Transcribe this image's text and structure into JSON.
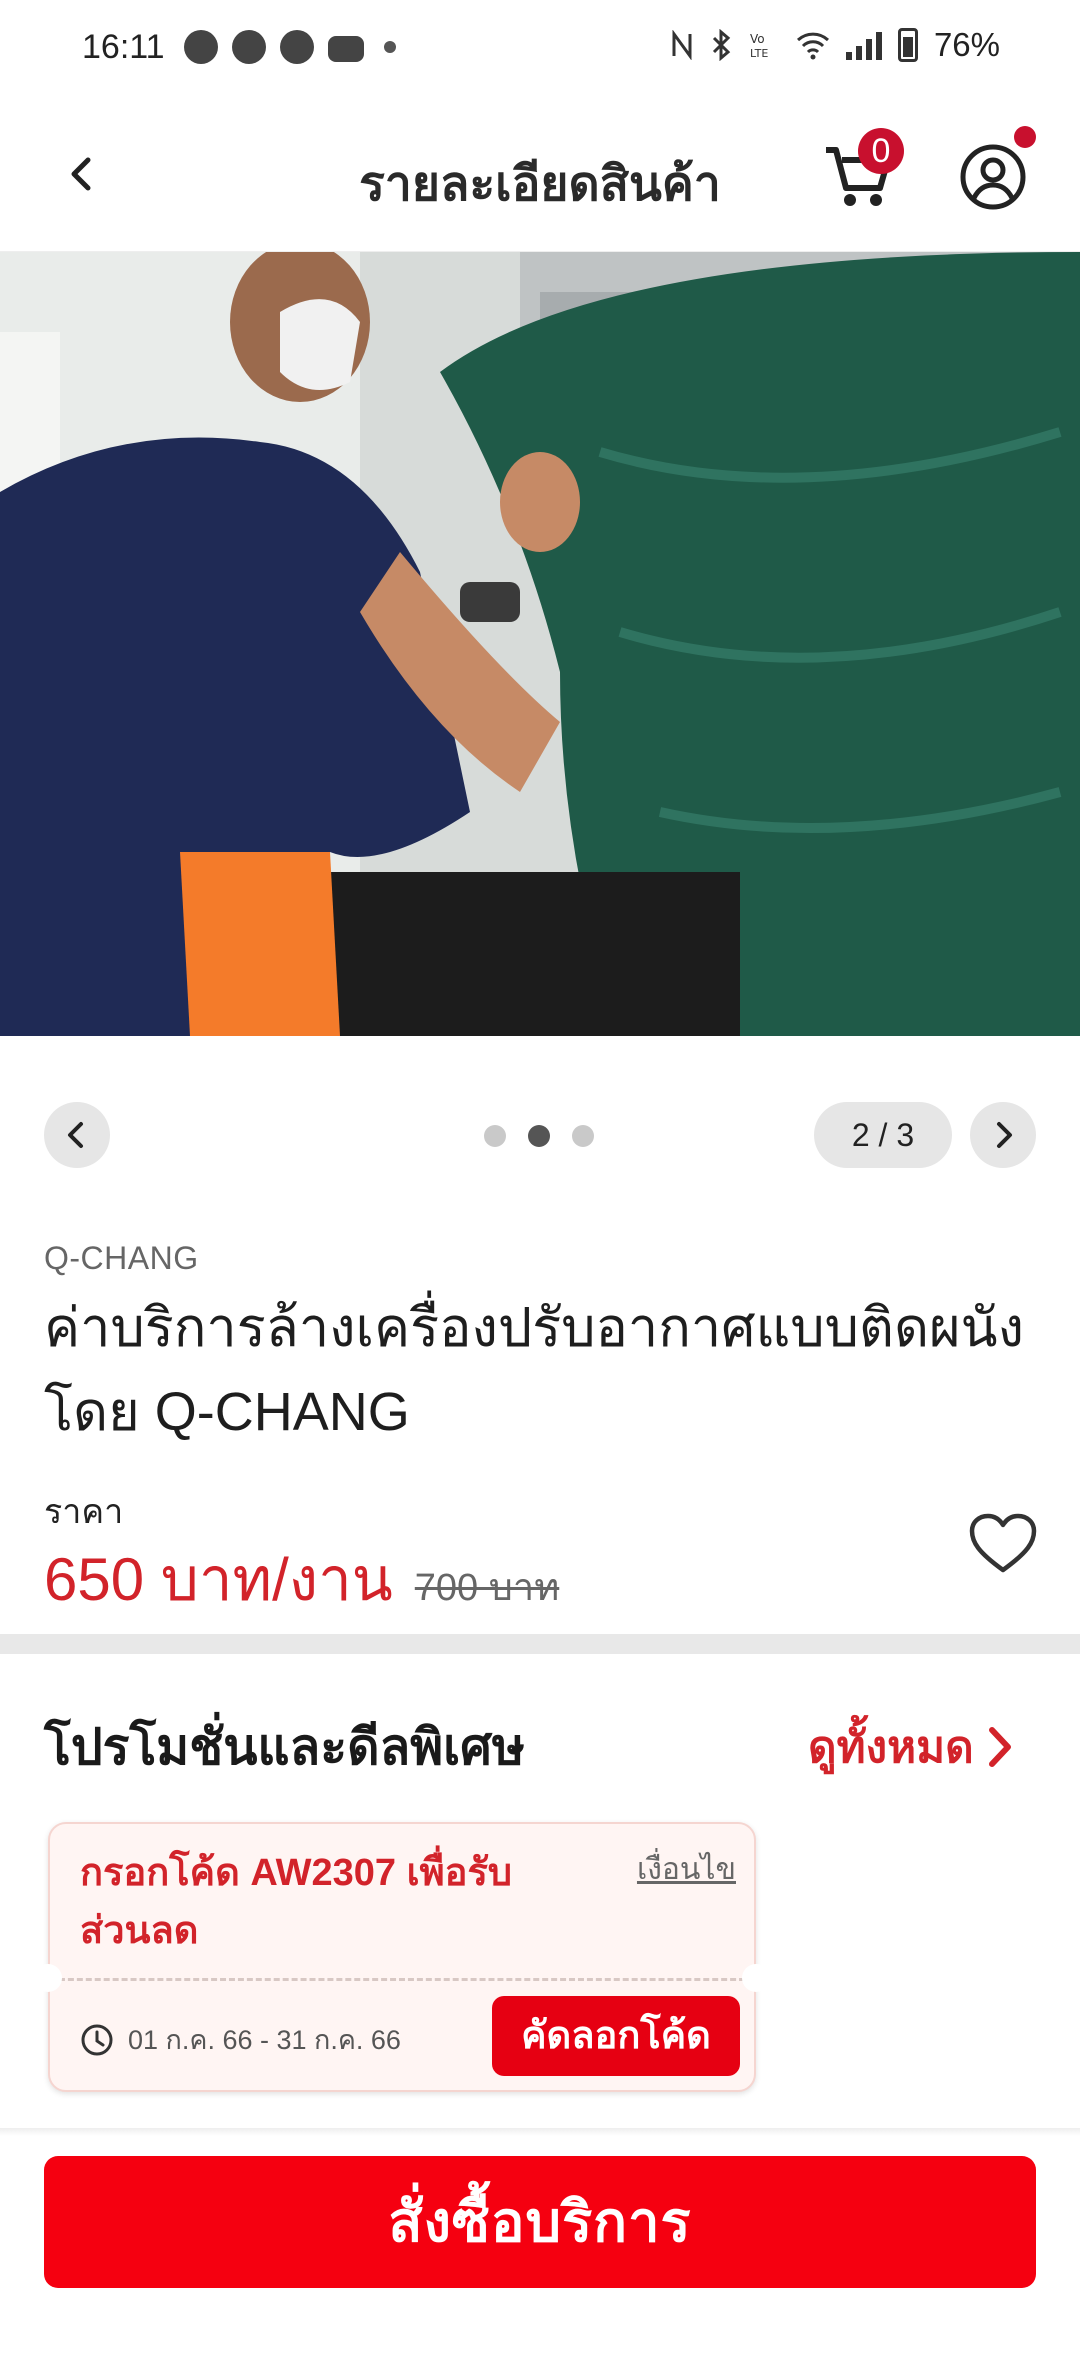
{
  "status_bar": {
    "time": "16:11",
    "battery": "76%",
    "icons": [
      "photo-app-icon",
      "messenger-icon",
      "speedometer-icon",
      "youtube-icon",
      "nfc-icon",
      "bluetooth-icon",
      "volte-icon",
      "wifi-icon",
      "signal-icon",
      "battery-icon"
    ]
  },
  "header": {
    "title": "รายละเอียดสินค้า",
    "cart_count": "0"
  },
  "gallery": {
    "counter": "2 / 3",
    "total": 3,
    "active_index": 2
  },
  "product": {
    "brand": "Q-CHANG",
    "title": "ค่าบริการล้างเครื่องปรับอากาศแบบติดผนัง โดย Q-CHANG",
    "price_label": "ราคา",
    "price": "650 บาท/งาน",
    "old_price": "700 บาท"
  },
  "promotions": {
    "title": "โปรโมชั่นและดีลพิเศษ",
    "see_all": "ดูทั้งหมด",
    "coupon": {
      "text": "กรอกโค้ด AW2307 เพื่อรับส่วนลด",
      "condition": "เงื่อนไข",
      "date_range": "01 ก.ค. 66 - 31 ก.ค. 66",
      "copy_label": "คัดลอกโค้ด"
    }
  },
  "order_button": "สั่งซื้อบริการ",
  "colors": {
    "accent_red": "#d2232a",
    "button_red": "#f50010",
    "badge_red": "#c8102e"
  }
}
